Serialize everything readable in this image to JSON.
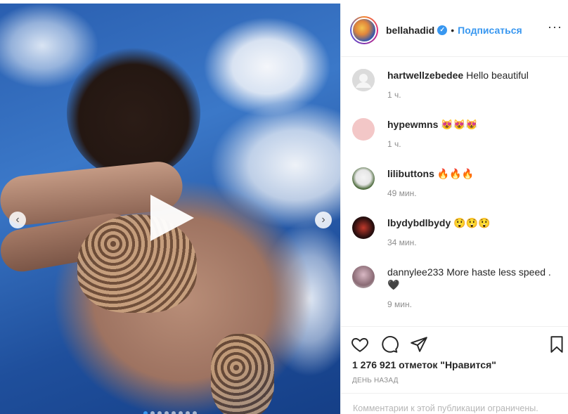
{
  "post": {
    "username": "bellahadid",
    "verified_icon": "verified-badge-icon",
    "separator": "•",
    "follow_label": "Подписаться",
    "more_label": "···"
  },
  "media": {
    "type": "video",
    "play_icon": "play-icon",
    "prev_icon": "chevron-left-icon",
    "next_icon": "chevron-right-icon",
    "prev_glyph": "‹",
    "next_glyph": "›",
    "dots_count": 8,
    "active_dot": 0
  },
  "comments": [
    {
      "username": "hartwellzebedee",
      "text": "Hello beautiful",
      "time": "1 ч."
    },
    {
      "username": "hypewmns",
      "text": "😻😻😻",
      "time": "1 ч."
    },
    {
      "username": "lilibuttons",
      "text": "🔥🔥🔥",
      "time": "49 мин."
    },
    {
      "username": "lbydybdlbydy",
      "text": "😲😲😲",
      "time": "34 мин."
    },
    {
      "username": "dannylee233",
      "text": "More haste less speed . 🖤",
      "time": "9 мин."
    }
  ],
  "actions": {
    "like_icon": "heart-icon",
    "comment_icon": "comment-icon",
    "share_icon": "share-icon",
    "save_icon": "bookmark-icon",
    "likes_text": "1 276 921 отметок \"Нравится\"",
    "date_text": "ДЕНЬ НАЗАД",
    "restricted_text": "Комментарии к этой публикации ограничены."
  },
  "colors": {
    "accent": "#3897f0",
    "text": "#262626",
    "muted": "#8e8e8e",
    "border": "#efefef"
  }
}
